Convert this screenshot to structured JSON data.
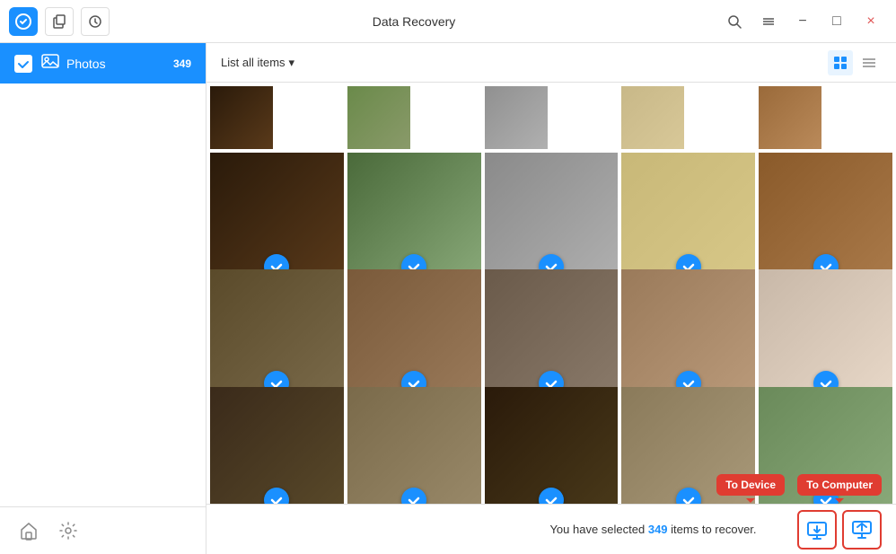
{
  "titlebar": {
    "title": "Data Recovery",
    "minimize_label": "−",
    "maximize_label": "□",
    "close_label": "×"
  },
  "toolbar": {
    "list_all_label": "List all items",
    "dropdown_icon": "▾"
  },
  "sidebar": {
    "photos_label": "Photos",
    "photos_count": "349"
  },
  "status": {
    "prefix": "You have selected ",
    "count": "349",
    "suffix": " items to recover."
  },
  "tooltips": {
    "device": "To Device",
    "computer": "To Computer"
  },
  "photos": [
    {
      "id": 1,
      "cls": "photo-1",
      "row": "partial"
    },
    {
      "id": 2,
      "cls": "photo-2",
      "row": "partial"
    },
    {
      "id": 3,
      "cls": "photo-3",
      "row": "partial"
    },
    {
      "id": 4,
      "cls": "photo-4",
      "row": "partial"
    },
    {
      "id": 5,
      "cls": "photo-5",
      "row": "partial"
    },
    {
      "id": 6,
      "cls": "photo-1"
    },
    {
      "id": 7,
      "cls": "photo-2"
    },
    {
      "id": 8,
      "cls": "photo-3"
    },
    {
      "id": 9,
      "cls": "photo-4"
    },
    {
      "id": 10,
      "cls": "photo-5"
    },
    {
      "id": 11,
      "cls": "photo-6"
    },
    {
      "id": 12,
      "cls": "photo-7"
    },
    {
      "id": 13,
      "cls": "photo-8"
    },
    {
      "id": 14,
      "cls": "photo-9"
    },
    {
      "id": 15,
      "cls": "photo-10"
    },
    {
      "id": 16,
      "cls": "photo-11"
    },
    {
      "id": 17,
      "cls": "photo-12"
    },
    {
      "id": 18,
      "cls": "photo-13"
    },
    {
      "id": 19,
      "cls": "photo-14"
    },
    {
      "id": 20,
      "cls": "photo-15"
    }
  ]
}
